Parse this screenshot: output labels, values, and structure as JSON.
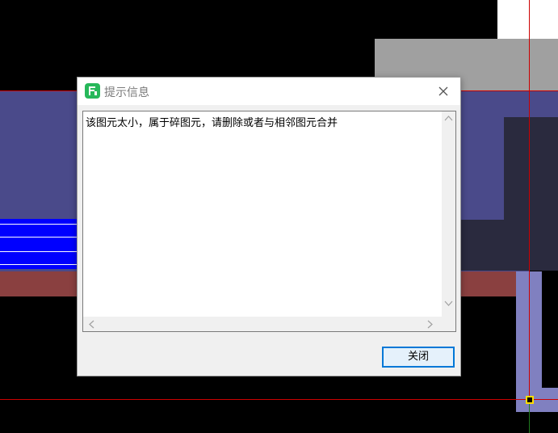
{
  "dialog": {
    "title": "提示信息",
    "message": "该图元太小，属于碎图元，请删除或者与相邻图元合并",
    "close_button_label": "关闭"
  },
  "icons": {
    "app": "app-logo-icon",
    "close": "close-icon",
    "scroll_up": "scroll-up-arrow-icon",
    "scroll_down": "scroll-down-arrow-icon",
    "scroll_left": "scroll-left-arrow-icon",
    "scroll_right": "scroll-right-arrow-icon"
  },
  "colors": {
    "canvas_bg": "#000000",
    "layer_purple": "#4a4a8a",
    "layer_dark": "#2a2a3e",
    "layer_red": "#8a4040",
    "layer_blue": "#0000ff",
    "layer_gray": "#a0a0a0",
    "layer_lavender": "#8080c0",
    "guide_line": "#cc0000",
    "accent": "#0078d7",
    "app_icon": "#27b85a"
  }
}
